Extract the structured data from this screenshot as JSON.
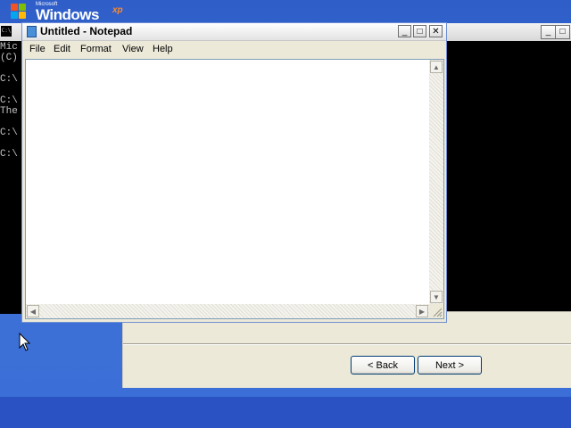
{
  "desktop": {
    "logo": {
      "microsoft": "Microsoft",
      "windows": "Windows",
      "xp": "xp"
    }
  },
  "console": {
    "icon_text": "C:\\",
    "lines": [
      "Mic",
      "(C)",
      "C:\\",
      "C:\\",
      "The",
      "C:\\",
      "C:\\"
    ],
    "controls": {
      "minimize": "_",
      "maximize": "□"
    }
  },
  "notepad": {
    "title": "Untitled - Notepad",
    "controls": {
      "minimize": "_",
      "maximize": "□",
      "close": "✕"
    },
    "menu": [
      "File",
      "Edit",
      "Format",
      "View",
      "Help"
    ],
    "content": ""
  },
  "wizard": {
    "back_label": "< Back",
    "next_label": "Next >"
  },
  "colors": {
    "desktop_blue": "#3f72d6",
    "console_bg": "#000000",
    "console_text": "#c0c0c0",
    "dialog_face": "#ece9d8"
  }
}
